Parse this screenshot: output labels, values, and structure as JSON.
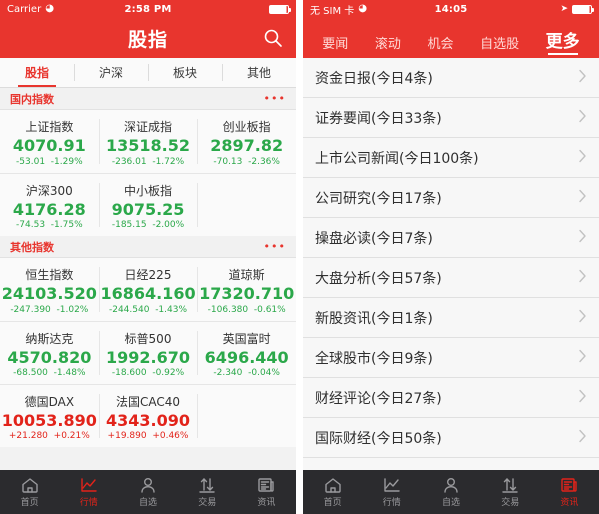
{
  "colors": {
    "brand_red": "#e8352e",
    "up_red": "#e2231a",
    "down_green": "#2ba84a",
    "tabbar_dark": "#2b2b2e"
  },
  "left_screen": {
    "status_bar": {
      "carrier": "Carrier",
      "wifi_icon": "wifi-icon",
      "time": "2:58 PM",
      "battery_icon": "battery-icon"
    },
    "nav": {
      "title": "股指",
      "search_icon": "search-icon"
    },
    "segments": [
      {
        "label": "股指",
        "active": true
      },
      {
        "label": "沪深",
        "active": false
      },
      {
        "label": "板块",
        "active": false
      },
      {
        "label": "其他",
        "active": false
      }
    ],
    "sections": [
      {
        "title": "国内指数",
        "more_icon": "more-dots-icon",
        "rows": [
          [
            {
              "name": "上证指数",
              "price": "4070.91",
              "change": "-53.01",
              "percent": "-1.29%",
              "dir": "down"
            },
            {
              "name": "深证成指",
              "price": "13518.52",
              "change": "-236.01",
              "percent": "-1.72%",
              "dir": "down"
            },
            {
              "name": "创业板指",
              "price": "2897.82",
              "change": "-70.13",
              "percent": "-2.36%",
              "dir": "down"
            }
          ],
          [
            {
              "name": "沪深300",
              "price": "4176.28",
              "change": "-74.53",
              "percent": "-1.75%",
              "dir": "down"
            },
            {
              "name": "中小板指",
              "price": "9075.25",
              "change": "-185.15",
              "percent": "-2.00%",
              "dir": "down"
            },
            {
              "name": "",
              "price": "",
              "change": "",
              "percent": "",
              "dir": "empty"
            }
          ]
        ]
      },
      {
        "title": "其他指数",
        "more_icon": "more-dots-icon",
        "rows": [
          [
            {
              "name": "恒生指数",
              "price": "24103.520",
              "change": "-247.390",
              "percent": "-1.02%",
              "dir": "down"
            },
            {
              "name": "日经225",
              "price": "16864.160",
              "change": "-244.540",
              "percent": "-1.43%",
              "dir": "down"
            },
            {
              "name": "道琼斯",
              "price": "17320.710",
              "change": "-106.380",
              "percent": "-0.61%",
              "dir": "down"
            }
          ],
          [
            {
              "name": "纳斯达克",
              "price": "4570.820",
              "change": "-68.500",
              "percent": "-1.48%",
              "dir": "down"
            },
            {
              "name": "标普500",
              "price": "1992.670",
              "change": "-18.600",
              "percent": "-0.92%",
              "dir": "down"
            },
            {
              "name": "英国富时",
              "price": "6496.440",
              "change": "-2.340",
              "percent": "-0.04%",
              "dir": "down"
            }
          ],
          [
            {
              "name": "德国DAX",
              "price": "10053.890",
              "change": "+21.280",
              "percent": "+0.21%",
              "dir": "up"
            },
            {
              "name": "法国CAC40",
              "price": "4343.090",
              "change": "+19.890",
              "percent": "+0.46%",
              "dir": "up"
            },
            {
              "name": "",
              "price": "",
              "change": "",
              "percent": "",
              "dir": "empty"
            }
          ]
        ]
      }
    ],
    "tabbar": [
      {
        "label": "首页",
        "icon": "home-icon",
        "active": false
      },
      {
        "label": "行情",
        "icon": "chart-icon",
        "active": true
      },
      {
        "label": "自选",
        "icon": "person-icon",
        "active": false
      },
      {
        "label": "交易",
        "icon": "transfer-icon",
        "active": false
      },
      {
        "label": "资讯",
        "icon": "news-icon",
        "active": false
      }
    ]
  },
  "right_screen": {
    "status_bar": {
      "carrier": "无 SIM 卡",
      "wifi_icon": "wifi-icon",
      "time": "14:05",
      "location_icon": "location-arrow-icon",
      "battery_icon": "battery-icon"
    },
    "tabs": [
      {
        "label": "要闻",
        "active": false
      },
      {
        "label": "滚动",
        "active": false
      },
      {
        "label": "机会",
        "active": false
      },
      {
        "label": "自选股",
        "active": false
      },
      {
        "label": "更多",
        "active": true
      }
    ],
    "list": [
      {
        "label": "资金日报(今日4条)",
        "chevron": "chevron-right-icon"
      },
      {
        "label": "证券要闻(今日33条)",
        "chevron": "chevron-right-icon"
      },
      {
        "label": "上市公司新闻(今日100条)",
        "chevron": "chevron-right-icon"
      },
      {
        "label": "公司研究(今日17条)",
        "chevron": "chevron-right-icon"
      },
      {
        "label": "操盘必读(今日7条)",
        "chevron": "chevron-right-icon"
      },
      {
        "label": "大盘分析(今日57条)",
        "chevron": "chevron-right-icon"
      },
      {
        "label": "新股资讯(今日1条)",
        "chevron": "chevron-right-icon"
      },
      {
        "label": "全球股市(今日9条)",
        "chevron": "chevron-right-icon"
      },
      {
        "label": "财经评论(今日27条)",
        "chevron": "chevron-right-icon"
      },
      {
        "label": "国际财经(今日50条)",
        "chevron": "chevron-right-icon"
      }
    ],
    "tabbar": [
      {
        "label": "首页",
        "icon": "home-icon",
        "active": false
      },
      {
        "label": "行情",
        "icon": "chart-icon",
        "active": false
      },
      {
        "label": "自选",
        "icon": "person-icon",
        "active": false
      },
      {
        "label": "交易",
        "icon": "transfer-icon",
        "active": false
      },
      {
        "label": "资讯",
        "icon": "news-icon",
        "active": true
      }
    ]
  }
}
